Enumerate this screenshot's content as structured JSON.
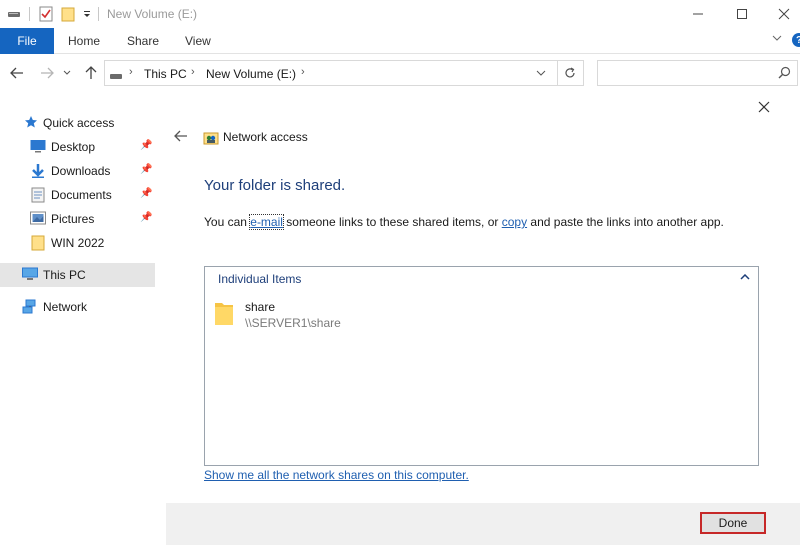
{
  "window": {
    "title": "New Volume (E:)",
    "quick_access_toolbar": [
      "drive-icon",
      "properties-checklist-icon",
      "new-folder-icon",
      "customize-dropdown-icon"
    ],
    "controls": [
      "minimize-icon",
      "maximize-icon",
      "close-icon"
    ]
  },
  "ribbon": {
    "file": "File",
    "tabs": [
      "Home",
      "Share",
      "View"
    ],
    "help": "?"
  },
  "nav": {
    "breadcrumb": [
      "This PC",
      "New Volume (E:)"
    ],
    "search_placeholder": ""
  },
  "sidebar": {
    "quick_access": "Quick access",
    "items": [
      {
        "label": "Desktop",
        "icon": "desktop-icon",
        "pinned": true
      },
      {
        "label": "Downloads",
        "icon": "downloads-icon",
        "pinned": true
      },
      {
        "label": "Documents",
        "icon": "documents-icon",
        "pinned": true
      },
      {
        "label": "Pictures",
        "icon": "pictures-icon",
        "pinned": true
      },
      {
        "label": "WIN 2022",
        "icon": "folder-icon",
        "pinned": false
      }
    ],
    "this_pc": "This PC",
    "network": "Network"
  },
  "dialog": {
    "wizard_title": "Network access",
    "heading": "Your folder is shared.",
    "message": {
      "prefix": "You can ",
      "email_link": "e-mail",
      "middle": " someone links to these shared items, or ",
      "copy_link": "copy",
      "suffix": " and paste the links into another app."
    },
    "items_header": "Individual Items",
    "items": [
      {
        "name": "share",
        "path": "\\\\SERVER1\\share"
      }
    ],
    "show_all_link": "Show me all the network shares on this computer.",
    "done_button": "Done"
  },
  "colors": {
    "accent": "#1565c0",
    "heading": "#1e3f7a",
    "link": "#1f5fb0",
    "highlight_border": "#c62828"
  }
}
